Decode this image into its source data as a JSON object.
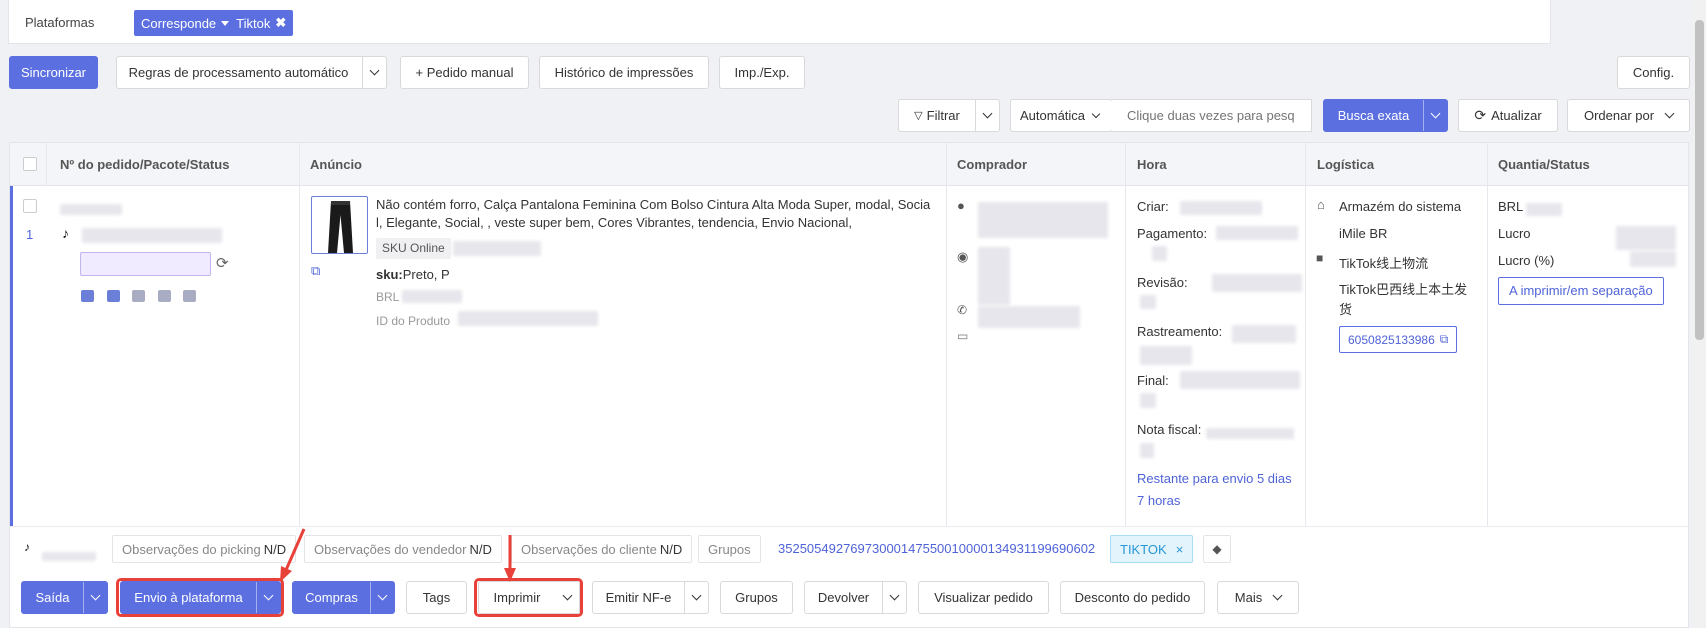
{
  "filter": {
    "label": "Plataformas",
    "chip_mode": "Corresponde",
    "chip_value": "Tiktok"
  },
  "toolbar1": {
    "sync": "Sincronizar",
    "rules": "Regras de processamento automático",
    "manual": "+ Pedido manual",
    "print_history": "Histórico de impressões",
    "impexp": "Imp./Exp.",
    "config": "Config."
  },
  "toolbar2": {
    "filter": "Filtrar",
    "auto": "Automática",
    "search_placeholder": "Clique duas vezes para pesq",
    "exact": "Busca exata",
    "refresh": "Atualizar",
    "sort": "Ordenar por"
  },
  "table": {
    "headers": [
      "Nº do pedido/Pacote/Status",
      "Anúncio",
      "Comprador",
      "Hora",
      "Logística",
      "Quantia/Status"
    ]
  },
  "order": {
    "index": "1",
    "title": "Não contém forro, Calça Pantalona Feminina Com Bolso Cintura Alta Moda Super, modal, Social, Elegante, Social, , veste super bem, Cores Vibrantes, tendencia, Envio Nacional,",
    "sku_online": "SKU Online",
    "sku_label": "sku:",
    "sku_value": "Preto, P",
    "currency": "BRL",
    "product_id_label": "ID do Produto",
    "time": {
      "created": "Criar:",
      "payment": "Pagamento:",
      "review": "Revisão:",
      "tracking": "Rastreamento:",
      "final": "Final:",
      "invoice": "Nota fiscal:",
      "remaining": "Restante para envio 5 dias 7 horas"
    },
    "logistics": {
      "warehouse": "Armazém do sistema",
      "carrier": "iMile BR",
      "channel": "TikTok线上物流",
      "channel_detail": "TikTok巴西线上本土发货",
      "tracking_no": "6050825133986"
    },
    "amount": {
      "currency": "BRL",
      "profit": "Lucro",
      "profit_pct": "Lucro (%)",
      "status": "A imprimir/em separação"
    }
  },
  "notes": {
    "picking": "Observações do picking",
    "seller": "Observações do vendedor",
    "client": "Observações do cliente",
    "na": "N/D",
    "groups": "Grupos",
    "package_no": "35250549276973000147550010000134931199690602",
    "tag": "TIKTOK"
  },
  "actions": {
    "exit": "Saída",
    "send": "Envio à plataforma",
    "purchases": "Compras",
    "tags": "Tags",
    "print": "Imprimir",
    "nfe": "Emitir NF-e",
    "groups": "Grupos",
    "return": "Devolver",
    "view": "Visualizar pedido",
    "discount": "Desconto do pedido",
    "more": "Mais"
  },
  "colors": {
    "primary": "#5b6fe0",
    "highlight": "#e8413a",
    "link": "#4f63d8"
  }
}
